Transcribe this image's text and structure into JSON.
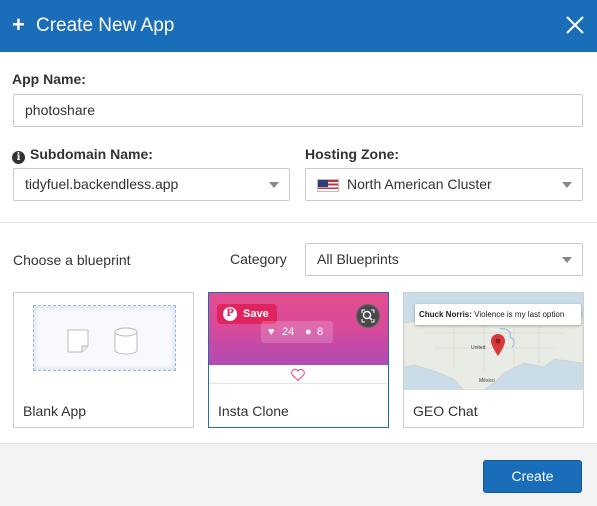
{
  "dialog": {
    "title": "Create New App",
    "plus_glyph": "+"
  },
  "form": {
    "app_name_label": "App Name:",
    "app_name_value": "photoshare",
    "subdomain_label": "Subdomain Name:",
    "subdomain_value": "tidyfuel.backendless.app",
    "hosting_zone_label": "Hosting Zone:",
    "hosting_zone_value": "North American Cluster"
  },
  "blueprints": {
    "choose_label": "Choose a blueprint",
    "category_label": "Category",
    "category_value": "All Blueprints",
    "cards": [
      {
        "label": "Blank App"
      },
      {
        "label": "Insta Clone",
        "pin_save": "Save",
        "pin_glyph": "P",
        "likes": "24",
        "followers": "8"
      },
      {
        "label": "GEO Chat",
        "tip_name": "Chuck Norris:",
        "tip_text": "Violence is my last option",
        "map_label_united": "United",
        "map_label_mexico": "México"
      }
    ]
  },
  "footer": {
    "create_label": "Create"
  },
  "icons": {
    "close": "close-icon",
    "info": "info-icon",
    "flag": "us-flag-icon",
    "caret": "chevron-down-icon"
  },
  "colors": {
    "header": "#1a6db8",
    "primary_button": "#1a6db8",
    "pinterest": "#e0245e",
    "map_marker": "#d9383a"
  }
}
